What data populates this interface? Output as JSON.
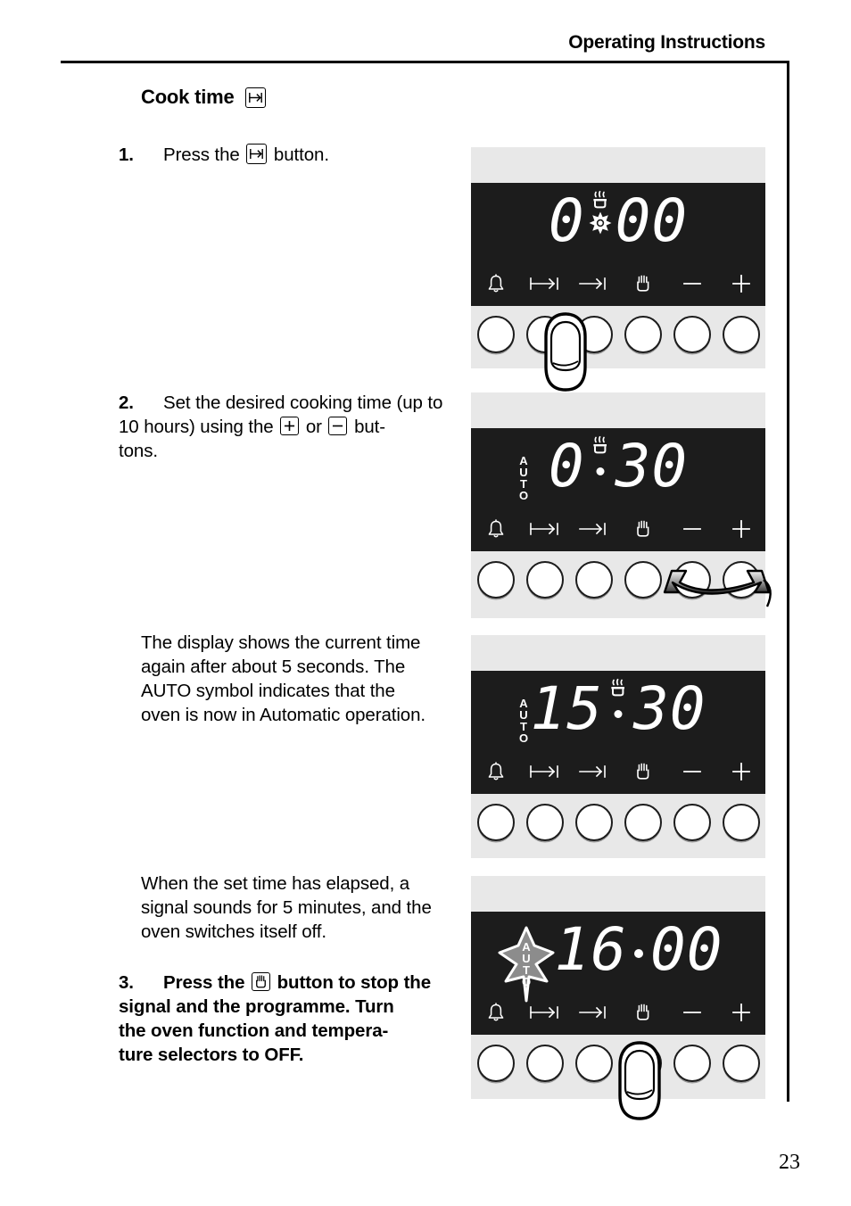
{
  "header": {
    "title": "Operating Instructions"
  },
  "page": {
    "number": "23"
  },
  "section": {
    "title": "Cook time",
    "title_icon": "cook-time-icon"
  },
  "steps": [
    {
      "number": "1.",
      "text_before": "Press the",
      "icon": "cook-time-icon",
      "text_after": "button."
    },
    {
      "number": "2.",
      "line1": "Set the desired cooking time (up to",
      "line2_a": "10 hours) using the",
      "icon_plus": "plus-icon",
      "line2_b": "or",
      "icon_minus": "minus-icon",
      "line2_c": "but-",
      "line3": "tons."
    },
    {
      "number": "3.",
      "text_before": "Press the",
      "icon": "hand-stop-icon",
      "line1_after": "button to stop the",
      "line2": "signal and the programme. Turn",
      "line3": "the oven function and tempera-",
      "line4": "ture selectors to OFF."
    }
  ],
  "notes": [
    {
      "line1": "The display shows the current time",
      "line2": "again after about 5 seconds. The",
      "line3": "AUTO symbol indicates that the",
      "line4": "oven is now in Automatic operation."
    },
    {
      "line1": "When the set time has elapsed, a",
      "line2": "signal sounds for 5 minutes, and the",
      "line3": "oven switches itself off."
    }
  ],
  "control_panel": {
    "button_icons": [
      {
        "name": "bell-icon",
        "label": "bell"
      },
      {
        "name": "cook-time-icon",
        "label": "cook time"
      },
      {
        "name": "end-time-icon",
        "label": "end time"
      },
      {
        "name": "hand-stop-icon",
        "label": "hand stop"
      },
      {
        "name": "minus-icon",
        "label": "minus"
      },
      {
        "name": "plus-icon",
        "label": "plus"
      }
    ],
    "auto_letters": [
      "A",
      "U",
      "T",
      "O"
    ]
  },
  "panels": [
    {
      "id": "panel-1",
      "display_value": "0:00",
      "digits": [
        "0",
        "0",
        "0"
      ],
      "separator": "cook-symbol",
      "auto": "none",
      "finger_on_button": 2,
      "arrow": "none"
    },
    {
      "id": "panel-2",
      "display_value": "0:30",
      "digits": [
        "0",
        "3",
        "0"
      ],
      "separator": "steam-dot",
      "auto": "steady",
      "finger_on_button": 0,
      "arrow": "plus-minus"
    },
    {
      "id": "panel-3",
      "display_value": "15:30",
      "digits": [
        "1",
        "5",
        "3",
        "0"
      ],
      "separator": "steam-dot",
      "auto": "steady",
      "finger_on_button": 0,
      "arrow": "none"
    },
    {
      "id": "panel-4",
      "display_value": "16:00",
      "digits": [
        "1",
        "6",
        "0",
        "0"
      ],
      "separator": "dot",
      "auto": "flashing",
      "finger_on_button": 4,
      "arrow": "none"
    }
  ],
  "colors": {
    "display_background": "#1c1c1c",
    "panel_background": "#e8e8e8",
    "digit_color": "#ffffff",
    "auto_flash_fill": "#8c8c8c",
    "page_background": "#ffffff",
    "text": "#000000"
  }
}
